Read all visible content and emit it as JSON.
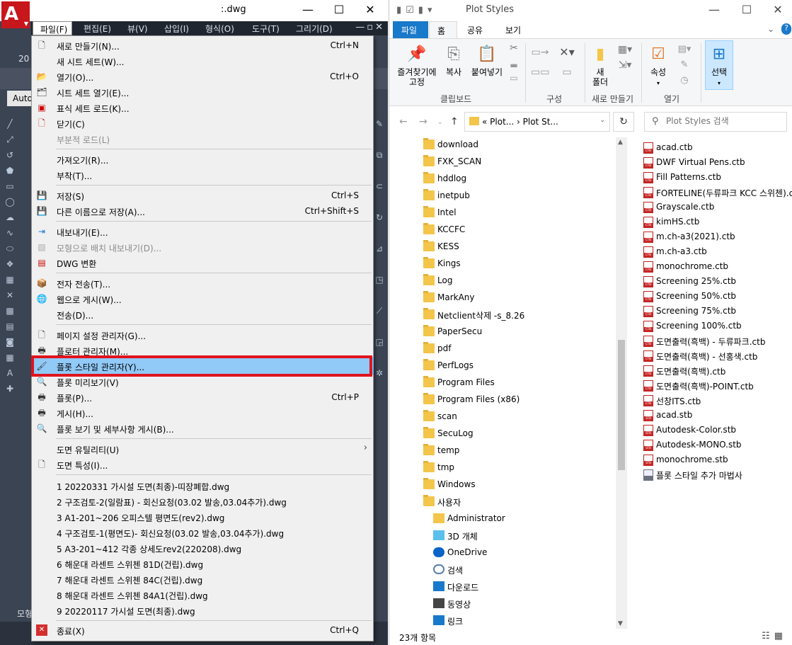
{
  "autocad": {
    "title": ":.dwg",
    "logo": "A",
    "tab_label": "20",
    "ribbon_label": "Auto",
    "model_label": "모형",
    "menubar": [
      "파일(F)",
      "편집(E)",
      "뷰(V)",
      "삽입(I)",
      "형식(O)",
      "도구(T)",
      "그리기(D)"
    ],
    "file_menu": {
      "new": {
        "label": "새로 만들기(N)...",
        "shortcut": "Ctrl+N"
      },
      "new_sheet_set": {
        "label": "새 시트 세트(W)..."
      },
      "open": {
        "label": "열기(O)...",
        "shortcut": "Ctrl+O"
      },
      "open_sheet_set": {
        "label": "시트 세트 열기(E)..."
      },
      "load_markup_set": {
        "label": "표식 세트 로드(K)..."
      },
      "close": {
        "label": "닫기(C)"
      },
      "partial_load": {
        "label": "부분적 로드(L)"
      },
      "import": {
        "label": "가져오기(R)..."
      },
      "attach": {
        "label": "부착(T)..."
      },
      "save": {
        "label": "저장(S)",
        "shortcut": "Ctrl+S"
      },
      "save_as": {
        "label": "다른 이름으로 저장(A)...",
        "shortcut": "Ctrl+Shift+S"
      },
      "export": {
        "label": "내보내기(E)..."
      },
      "export_layout": {
        "label": "모형으로 배치 내보내기(D)..."
      },
      "dwg_convert": {
        "label": "DWG 변환"
      },
      "etransmit": {
        "label": "전자 전송(T)..."
      },
      "publish_web": {
        "label": "웹으로 게시(W)..."
      },
      "send": {
        "label": "전송(D)..."
      },
      "page_setup": {
        "label": "페이지 설정 관리자(G)..."
      },
      "plotter_manager": {
        "label": "플로터 관리자(M)..."
      },
      "plot_style_manager": {
        "label": "플롯 스타일 관리자(Y)..."
      },
      "plot_preview": {
        "label": "플롯 미리보기(V)"
      },
      "plot": {
        "label": "플롯(P)...",
        "shortcut": "Ctrl+P"
      },
      "publish": {
        "label": "게시(H)..."
      },
      "view_plot_details": {
        "label": "플롯 보기 및 세부사항 게시(B)..."
      },
      "drawing_utilities": {
        "label": "도면 유틸리티(U)"
      },
      "drawing_properties": {
        "label": "도면 특성(I)..."
      },
      "recent_files": [
        "1 20220331 가시설 도면(최종)-띠장폐합.dwg",
        "2 구조검토-2(일람표) - 회신요청(03.02 발송,03.04추가).dwg",
        "3 A1-201~206 오피스텔 평면도(rev2).dwg",
        "4 구조검토-1(평면도)- 회신요청(03.02 발송,03.04추가).dwg",
        "5 A3-201~412 각종 상세도rev2(220208).dwg",
        "6 해운대 라센트 스위첸 81D(건립).dwg",
        "7 해운대 라센트 스위첸 84C(건립).dwg",
        "8 해운대 라센트 스위첸 84A1(건립).dwg",
        "9 20220117 가시설 도면(최종).dwg"
      ],
      "exit": {
        "label": "종료(X)",
        "shortcut": "Ctrl+Q"
      }
    }
  },
  "explorer": {
    "title": "Plot Styles",
    "tabs": {
      "file": "파일",
      "home": "홈",
      "share": "공유",
      "view": "보기"
    },
    "ribbon": {
      "pin_label": "즐겨찾기에\n고정",
      "copy": "복사",
      "paste": "붙여넣기",
      "clipboard_group": "클립보드",
      "organize_group": "구성",
      "new_folder": "새\n폴더",
      "new_group": "새로 만들기",
      "properties": "속성",
      "open_group": "열기",
      "select": "선택"
    },
    "address": {
      "path": "«  Plot...  ›  Plot St...",
      "search_placeholder": "Plot Styles 검색"
    },
    "nav_folders": [
      "download",
      "FXK_SCAN",
      "hddlog",
      "inetpub",
      "Intel",
      "KCCFC",
      "KESS",
      "Kings",
      "Log",
      "MarkAny",
      "Netclient삭제 -s_8.26",
      "PaperSecu",
      "pdf",
      "PerfLogs",
      "Program Files",
      "Program Files (x86)",
      "scan",
      "SecuLog",
      "temp",
      "tmp",
      "Windows",
      "사용자"
    ],
    "nav_special": [
      "Administrator",
      "3D 개체",
      "OneDrive",
      "검색",
      "다운로드",
      "동영상",
      "링크"
    ],
    "files_ctb": [
      "acad.ctb",
      "DWF Virtual Pens.ctb",
      "Fill Patterns.ctb",
      "FORTELINE(두류파크 KCC 스위첸).ctb",
      "Grayscale.ctb",
      "kimHS.ctb",
      "m.ch-a3(2021).ctb",
      "m.ch-a3.ctb",
      "monochrome.ctb",
      "Screening 25%.ctb",
      "Screening 50%.ctb",
      "Screening 75%.ctb",
      "Screening 100%.ctb",
      "도면출력(흑백) - 두류파크.ctb",
      "도면출력(흑백) - 선홍색.ctb",
      "도면출력(흑백).ctb",
      "도면출력(흑백)-POINT.ctb",
      "선창ITS.ctb"
    ],
    "files_stb": [
      "acad.stb",
      "Autodesk-Color.stb",
      "Autodesk-MONO.stb",
      "monochrome.stb"
    ],
    "wizard": "플롯 스타일 추가 마법사",
    "status": "23개 항목"
  }
}
